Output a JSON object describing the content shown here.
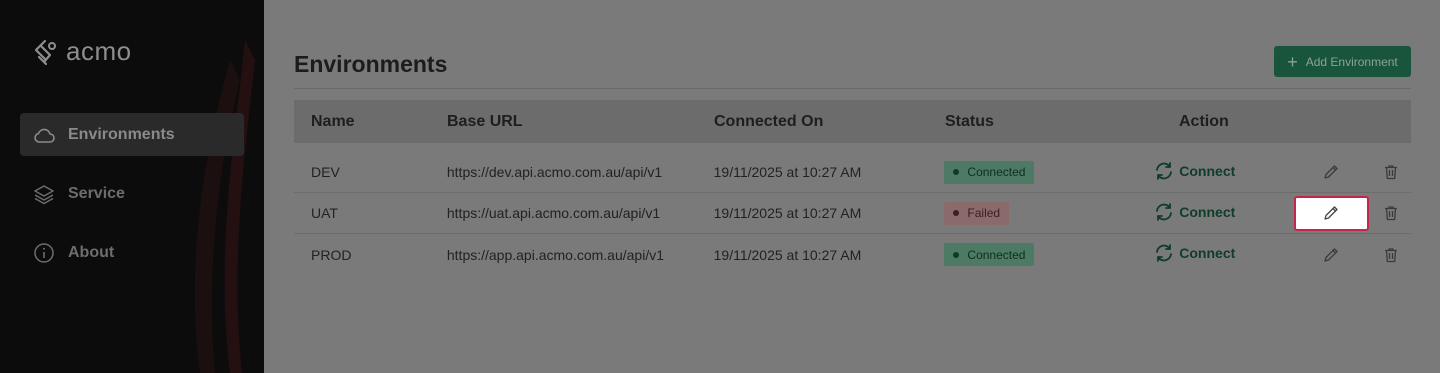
{
  "app": {
    "logo_text": "acmo"
  },
  "sidebar": {
    "items": [
      {
        "label": "Environments",
        "icon": "cloud-icon",
        "active": true
      },
      {
        "label": "Service",
        "icon": "layers-icon",
        "active": false
      },
      {
        "label": "About",
        "icon": "info-icon",
        "active": false
      }
    ]
  },
  "page": {
    "title": "Environments",
    "add_button_label": "Add Environment"
  },
  "table": {
    "columns": [
      "Name",
      "Base URL",
      "Connected On",
      "Status",
      "Action"
    ],
    "rows": [
      {
        "name": "DEV",
        "url": "https://dev.api.acmo.com.au/api/v1",
        "connected_on": "19/11/2025 at 10:27 AM",
        "status": "Connected",
        "action": "Connect"
      },
      {
        "name": "UAT",
        "url": "https://uat.api.acmo.com.au/api/v1",
        "connected_on": "19/11/2025 at 10:27 AM",
        "status": "Failed",
        "action": "Connect"
      },
      {
        "name": "PROD",
        "url": "https://app.api.acmo.com.au/api/v1",
        "connected_on": "19/11/2025 at 10:27 AM",
        "status": "Connected",
        "action": "Connect"
      }
    ]
  },
  "colors": {
    "accent": "#19543c",
    "highlight_border": "#c4264a"
  }
}
